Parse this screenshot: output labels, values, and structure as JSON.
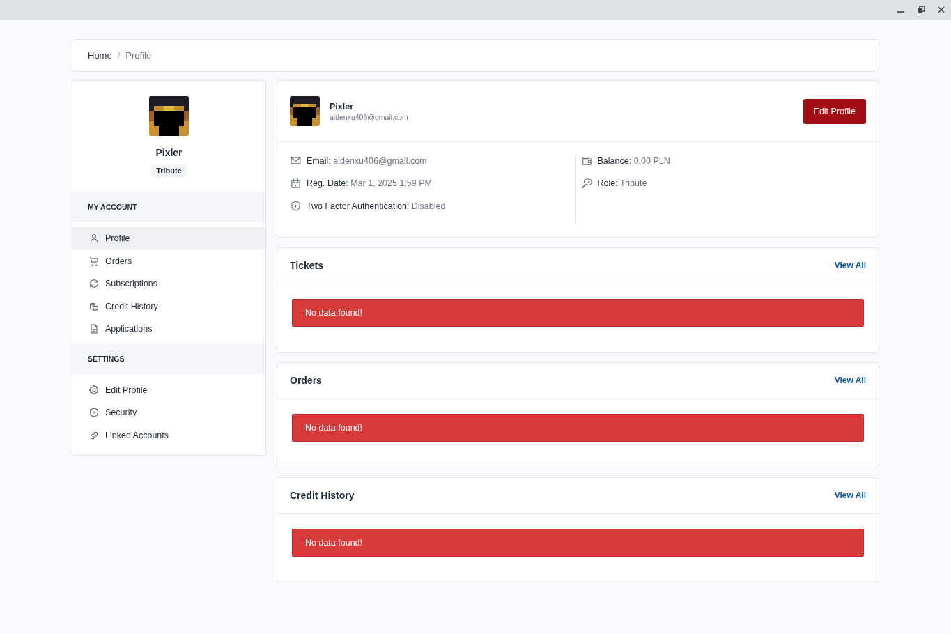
{
  "breadcrumb": [
    {
      "label": "Home",
      "current": false
    },
    {
      "separator": "/"
    },
    {
      "label": "Profile",
      "current": true
    }
  ],
  "user": {
    "name": "Pixler",
    "role_badge": "Tribute",
    "card_name": "Pixler",
    "email": "aidenxu406@gmail.com"
  },
  "sidebar": {
    "groups": [
      {
        "heading": "MY ACCOUNT",
        "items": [
          {
            "label": "Profile",
            "selected": true
          },
          {
            "label": "Orders",
            "selected": false
          },
          {
            "label": "Subscriptions",
            "selected": false
          },
          {
            "label": "Credit History",
            "selected": false
          },
          {
            "label": "Applications",
            "selected": false
          }
        ]
      },
      {
        "heading": "SETTINGS",
        "items": [
          {
            "label": "Edit Profile",
            "selected": false
          },
          {
            "label": "Security",
            "selected": false
          },
          {
            "label": "Linked Accounts",
            "selected": false
          }
        ]
      }
    ]
  },
  "edit_button": "Edit Profile",
  "details": {
    "left": [
      {
        "kind": "mail",
        "label": "Email:",
        "value": "aidenxu406@gmail.com"
      },
      {
        "kind": "calendar",
        "label": "Reg. Date:",
        "value": "Mar 1, 2025 1:59 PM"
      },
      {
        "kind": "shield",
        "label": "Two Factor Authentication:",
        "value": "Disabled"
      }
    ],
    "right": [
      {
        "kind": "wallet",
        "label": "Balance:",
        "value": "0.00 PLN"
      },
      {
        "kind": "key",
        "label": "Role:",
        "value": "Tribute"
      }
    ]
  },
  "sections": [
    {
      "title": "Tickets",
      "link": "View All",
      "message": "No data found!"
    },
    {
      "title": "Orders",
      "link": "View All",
      "message": "No data found!"
    },
    {
      "title": "Credit History",
      "link": "View All",
      "message": "No data found!"
    }
  ]
}
